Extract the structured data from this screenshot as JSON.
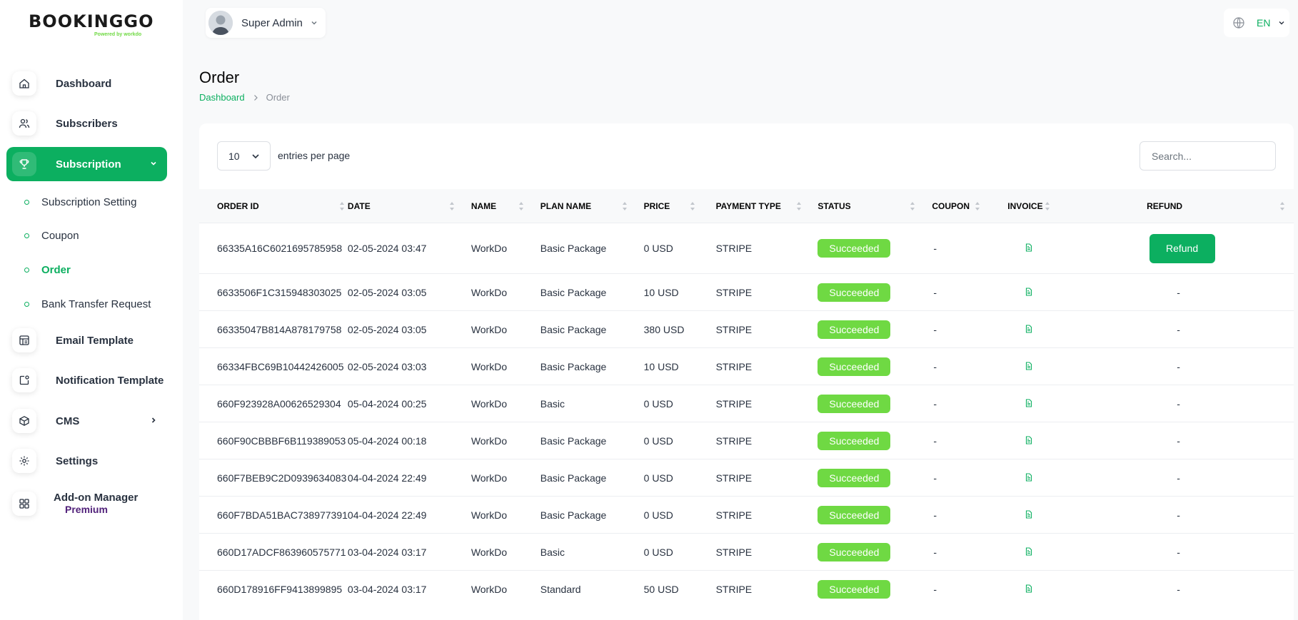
{
  "brand": {
    "name": "BOOKINGGO",
    "powered": "Powered by workdo"
  },
  "header": {
    "user_name": "Super Admin",
    "language": "EN"
  },
  "sidebar": {
    "items": [
      {
        "label": "Dashboard",
        "icon": "home-icon"
      },
      {
        "label": "Subscribers",
        "icon": "users-icon"
      },
      {
        "label": "Subscription",
        "icon": "trophy-icon",
        "active": true
      },
      {
        "label": "Email Template",
        "icon": "template-icon"
      },
      {
        "label": "Notification Template",
        "icon": "notification-icon"
      },
      {
        "label": "CMS",
        "icon": "box-icon"
      },
      {
        "label": "Settings",
        "icon": "gear-icon"
      },
      {
        "label": "Add-on Manager",
        "icon": "apps-icon"
      }
    ],
    "premium_label": "Premium",
    "subitems": [
      {
        "label": "Subscription Setting"
      },
      {
        "label": "Coupon"
      },
      {
        "label": "Order",
        "active": true
      },
      {
        "label": "Bank Transfer Request"
      }
    ]
  },
  "page": {
    "title": "Order",
    "breadcrumb": {
      "home": "Dashboard",
      "current": "Order"
    }
  },
  "table_controls": {
    "entries_value": "10",
    "entries_label": "entries per page",
    "search_placeholder": "Search..."
  },
  "table": {
    "columns": [
      "ORDER ID",
      "DATE",
      "NAME",
      "PLAN NAME",
      "PRICE",
      "PAYMENT TYPE",
      "STATUS",
      "COUPON",
      "INVOICE",
      "REFUND"
    ],
    "refund_label": "Refund",
    "rows": [
      {
        "order_id": "66335A16C6021695785958",
        "date": "02-05-2024 03:47",
        "name": "WorkDo",
        "plan": "Basic Package",
        "price": "0 USD",
        "payment": "STRIPE",
        "status": "Succeeded",
        "coupon": "-",
        "refund": "button"
      },
      {
        "order_id": "6633506F1C315948303025",
        "date": "02-05-2024 03:05",
        "name": "WorkDo",
        "plan": "Basic Package",
        "price": "10 USD",
        "payment": "STRIPE",
        "status": "Succeeded",
        "coupon": "-",
        "refund": "-"
      },
      {
        "order_id": "66335047B814A878179758",
        "date": "02-05-2024 03:05",
        "name": "WorkDo",
        "plan": "Basic Package",
        "price": "380 USD",
        "payment": "STRIPE",
        "status": "Succeeded",
        "coupon": "-",
        "refund": "-"
      },
      {
        "order_id": "66334FBC69B10442426005",
        "date": "02-05-2024 03:03",
        "name": "WorkDo",
        "plan": "Basic Package",
        "price": "10 USD",
        "payment": "STRIPE",
        "status": "Succeeded",
        "coupon": "-",
        "refund": "-"
      },
      {
        "order_id": "660F923928A00626529304",
        "date": "05-04-2024 00:25",
        "name": "WorkDo",
        "plan": "Basic",
        "price": "0 USD",
        "payment": "STRIPE",
        "status": "Succeeded",
        "coupon": "-",
        "refund": "-"
      },
      {
        "order_id": "660F90CBBBF6B119389053",
        "date": "05-04-2024 00:18",
        "name": "WorkDo",
        "plan": "Basic Package",
        "price": "0 USD",
        "payment": "STRIPE",
        "status": "Succeeded",
        "coupon": "-",
        "refund": "-"
      },
      {
        "order_id": "660F7BEB9C2D0939634083",
        "date": "04-04-2024 22:49",
        "name": "WorkDo",
        "plan": "Basic Package",
        "price": "0 USD",
        "payment": "STRIPE",
        "status": "Succeeded",
        "coupon": "-",
        "refund": "-"
      },
      {
        "order_id": "660F7BDA51BAC738977391",
        "date": "04-04-2024 22:49",
        "name": "WorkDo",
        "plan": "Basic Package",
        "price": "0 USD",
        "payment": "STRIPE",
        "status": "Succeeded",
        "coupon": "-",
        "refund": "-"
      },
      {
        "order_id": "660D17ADCF863960575771",
        "date": "03-04-2024 03:17",
        "name": "WorkDo",
        "plan": "Basic",
        "price": "0 USD",
        "payment": "STRIPE",
        "status": "Succeeded",
        "coupon": "-",
        "refund": "-"
      },
      {
        "order_id": "660D178916FF9413899895",
        "date": "03-04-2024 03:17",
        "name": "WorkDo",
        "plan": "Standard",
        "price": "50 USD",
        "payment": "STRIPE",
        "status": "Succeeded",
        "coupon": "-",
        "refund": "-"
      }
    ]
  },
  "colors": {
    "primary": "#0caf60",
    "badge": "#6fd943",
    "premium": "#51217a",
    "background": "#f8f9fa"
  }
}
